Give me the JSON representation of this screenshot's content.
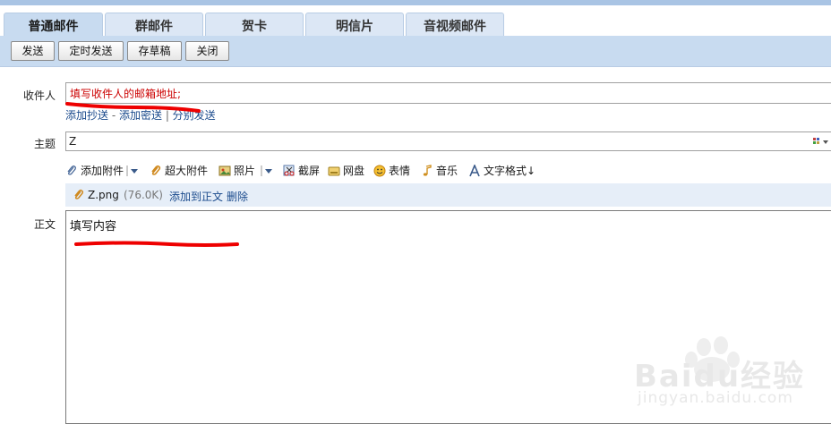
{
  "tabs": [
    {
      "label": "普通邮件",
      "active": true
    },
    {
      "label": "群邮件",
      "active": false
    },
    {
      "label": "贺卡",
      "active": false
    },
    {
      "label": "明信片",
      "active": false
    },
    {
      "label": "音视频邮件",
      "active": false
    }
  ],
  "buttons": {
    "send": "发送",
    "scheduled_send": "定时发送",
    "save_draft": "存草稿",
    "close": "关闭"
  },
  "recipient": {
    "label": "收件人",
    "value": "填写收件人的邮箱地址;"
  },
  "recipient_links": {
    "add_cc": "添加抄送",
    "sep1": " - ",
    "add_bcc": "添加密送",
    "sep2": " | ",
    "separate_send": "分别发送"
  },
  "subject": {
    "label": "主题",
    "value": "Z"
  },
  "toolbar": {
    "add_attachment": "添加附件",
    "large_attachment": "超大附件",
    "photo": "照片",
    "screenshot": "截屏",
    "netdisk": "网盘",
    "emoji": "表情",
    "music": "音乐",
    "text_format": "文字格式↓"
  },
  "attachment": {
    "filename": "Z.png",
    "size": "(76.0K)",
    "insert_label": "添加到正文",
    "delete_label": "删除"
  },
  "body": {
    "label": "正文",
    "content": "填写内容"
  },
  "watermark": {
    "brand": "Baidu经验",
    "url": "jingyan.baidu.com"
  },
  "colors": {
    "tab_bg": "#dce7f5",
    "active_tab_bg": "#c8dbf0",
    "link": "#1a4a8c",
    "recipient_text": "#cc0000",
    "annotation": "#ee0000"
  }
}
